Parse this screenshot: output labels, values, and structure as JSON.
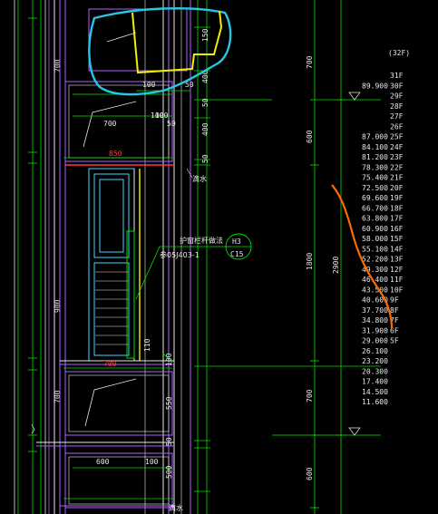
{
  "colors": {
    "background": "#000000",
    "dim_lines": "#00e000",
    "walls": "#b060ff",
    "window_frame": "#40d8ff",
    "text": "#e8e8e8",
    "red_note": "#ff3a3a",
    "cyan_markup": "#26c6e6",
    "yellow_markup": "#f0f000",
    "orange_markup": "#ff6a00"
  },
  "drawing": {
    "total_floors_label": "(32F)",
    "left_dims": [
      "700",
      "900",
      "700"
    ],
    "detail_dims": {
      "d150": "150",
      "d100_a": "100",
      "d50_a": "50",
      "d400_a": "400",
      "d50_b": "50",
      "d100_b": "100",
      "d700": "700",
      "d100_c": "100",
      "d50_c": "50",
      "d400_b": "400",
      "d50_d": "50",
      "d850": "850",
      "d700_b": "700",
      "d100_d": "100",
      "d550": "550",
      "d50_e": "50",
      "d600": "600",
      "d100_e": "100",
      "d500": "500",
      "d110": "110"
    },
    "note_label": "护窗栏杆做法",
    "note_ref": "参05J403-1",
    "callout_top": "H3",
    "callout_bottom": "C15",
    "small_note_a": "滴水",
    "small_note_b": "滴水",
    "right_dims": [
      "700",
      "600",
      "1800",
      "700",
      "600"
    ],
    "total_dim": "2900"
  },
  "levels": [
    {
      "elev": "",
      "floor": "31F"
    },
    {
      "elev": "89.900",
      "floor": "30F"
    },
    {
      "elev": "",
      "floor": "29F"
    },
    {
      "elev": "",
      "floor": "28F"
    },
    {
      "elev": "",
      "floor": "27F"
    },
    {
      "elev": "",
      "floor": "26F"
    },
    {
      "elev": "87.000",
      "floor": "25F"
    },
    {
      "elev": "84.100",
      "floor": "24F"
    },
    {
      "elev": "81.200",
      "floor": "23F"
    },
    {
      "elev": "78.300",
      "floor": "22F"
    },
    {
      "elev": "75.400",
      "floor": "21F"
    },
    {
      "elev": "72.500",
      "floor": "20F"
    },
    {
      "elev": "69.600",
      "floor": "19F"
    },
    {
      "elev": "66.700",
      "floor": "18F"
    },
    {
      "elev": "63.800",
      "floor": "17F"
    },
    {
      "elev": "60.900",
      "floor": "16F"
    },
    {
      "elev": "58.000",
      "floor": "15F"
    },
    {
      "elev": "55.100",
      "floor": "14F"
    },
    {
      "elev": "52.200",
      "floor": "13F"
    },
    {
      "elev": "49.300",
      "floor": "12F"
    },
    {
      "elev": "46.400",
      "floor": "11F"
    },
    {
      "elev": "43.500",
      "floor": "10F"
    },
    {
      "elev": "40.600",
      "floor": "9F"
    },
    {
      "elev": "37.700",
      "floor": "8F"
    },
    {
      "elev": "34.800",
      "floor": "7F"
    },
    {
      "elev": "31.900",
      "floor": "6F"
    },
    {
      "elev": "29.000",
      "floor": "5F"
    },
    {
      "elev": "26.100",
      "floor": ""
    },
    {
      "elev": "23.200",
      "floor": ""
    },
    {
      "elev": "20.300",
      "floor": ""
    },
    {
      "elev": "17.400",
      "floor": ""
    },
    {
      "elev": "14.500",
      "floor": ""
    },
    {
      "elev": "11.600",
      "floor": ""
    }
  ]
}
